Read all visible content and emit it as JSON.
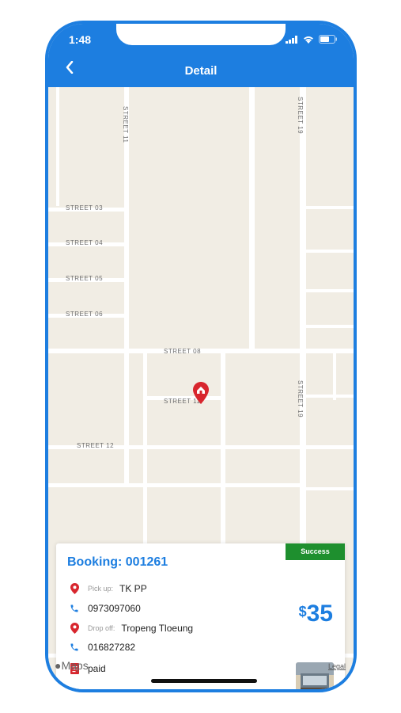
{
  "status_bar": {
    "time": "1:48"
  },
  "header": {
    "title": "Detail"
  },
  "map": {
    "streets": [
      "STREET 03",
      "STREET 04",
      "STREET 05",
      "STREET 06",
      "STREET 08",
      "STREET 11",
      "STREET 12",
      "STREET 19",
      "STREET 19",
      "STREET 11"
    ],
    "attribution": "Maps",
    "legal": "Legal"
  },
  "booking": {
    "title": "Booking: 001261",
    "status": "Success",
    "pickup_label": "Pick up:",
    "pickup_value": "TK PP",
    "pickup_phone": "0973097060",
    "dropoff_label": "Drop off:",
    "dropoff_value": "Tropeng Tloeung",
    "dropoff_phone": "016827282",
    "payment": "paid",
    "currency": "$",
    "price": "35"
  },
  "colors": {
    "primary": "#1d7ee0",
    "success": "#1e8f2e",
    "pin": "#d8262e"
  }
}
